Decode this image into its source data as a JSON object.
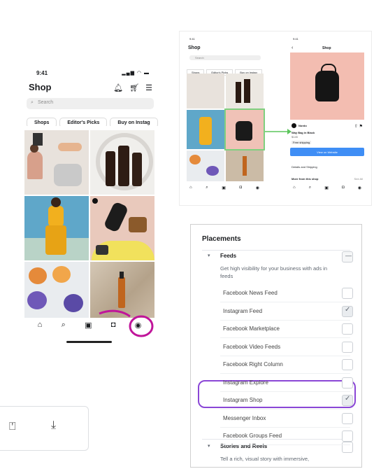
{
  "phone1": {
    "time": "9:41",
    "title": "Shop",
    "search_placeholder": "Search",
    "pills": [
      "Shops",
      "Editor's Picks",
      "Buy on Instag"
    ]
  },
  "phone2": {
    "left_title": "Shop",
    "search_placeholder": "Search",
    "pills": [
      "Shops",
      "Editor's Picks",
      "Buy on Instag"
    ],
    "right_title": "Shop",
    "product_brand": "Nordo",
    "product_name": "Way Bag in Black",
    "product_price": "$145",
    "product_tag": "Free shipping",
    "cta_label": "View on Website",
    "details_label": "Details and Shipping",
    "more_label": "More from this shop",
    "more_link": "See All"
  },
  "placements": {
    "heading": "Placements",
    "feeds_label": "Feeds",
    "feeds_desc": "Get high visibility for your business with ads in feeds",
    "items": [
      {
        "label": "Facebook News Feed",
        "checked": false
      },
      {
        "label": "Instagram Feed",
        "checked": true
      },
      {
        "label": "Facebook Marketplace",
        "checked": false
      },
      {
        "label": "Facebook Video Feeds",
        "checked": false
      },
      {
        "label": "Facebook Right Column",
        "checked": false
      },
      {
        "label": "Instagram Explore",
        "checked": false
      },
      {
        "label": "Instagram Shop",
        "checked": true
      },
      {
        "label": "Messenger Inbox",
        "checked": false
      },
      {
        "label": "Facebook Groups Feed",
        "checked": false
      }
    ],
    "stories_label": "Stories and Reels",
    "stories_desc": "Tell a rich, visual story with immersive,"
  },
  "colors": {
    "accent_circle": "#c0159a",
    "placement_highlight": "#8a46d6",
    "link_arrow": "#5cc55c",
    "cta_blue": "#3f8ef5"
  }
}
